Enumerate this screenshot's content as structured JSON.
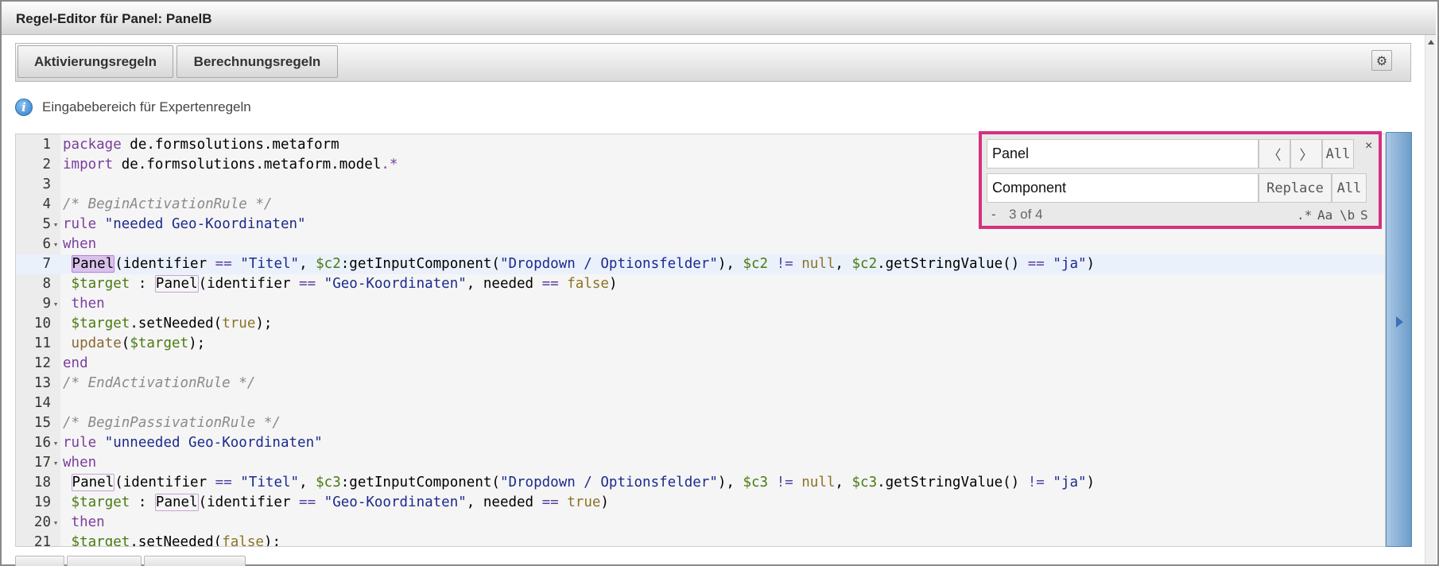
{
  "window": {
    "title": "Regel-Editor für Panel: PanelB"
  },
  "toolbar": {
    "activation_label": "Aktivierungsregeln",
    "calculation_label": "Berechnungsregeln",
    "settings_glyph": "⚙"
  },
  "info": {
    "icon_glyph": "i",
    "text": "Eingabebereich für Expertenregeln"
  },
  "search": {
    "find_value": "Panel",
    "replace_value": "Component",
    "prev_glyph": "〈",
    "next_glyph": "〉",
    "find_all_label": "All",
    "replace_label": "Replace",
    "replace_all_label": "All",
    "close_glyph": "×",
    "toggle_glyph": "-",
    "counter": "3 of 4",
    "opt_regex": ".*",
    "opt_case": "Aa",
    "opt_word": "\\b",
    "opt_selection": "S"
  },
  "editor": {
    "fold_glyph": "▾",
    "lines": [
      {
        "n": "1",
        "t": "package de.formsolutions.metaform"
      },
      {
        "n": "2",
        "t": "import de.formsolutions.metaform.model.*"
      },
      {
        "n": "3",
        "t": ""
      },
      {
        "n": "4",
        "t": "/* BeginActivationRule */"
      },
      {
        "n": "5",
        "t": "rule \"needed Geo-Koordinaten\""
      },
      {
        "n": "6",
        "t": "when"
      },
      {
        "n": "7",
        "t": " Panel(identifier == \"Titel\", $c2:getInputComponent(\"Dropdown / Optionsfelder\"), $c2 != null, $c2.getStringValue() == \"ja\")"
      },
      {
        "n": "8",
        "t": " $target : Panel(identifier == \"Geo-Koordinaten\", needed == false)"
      },
      {
        "n": "9",
        "t": " then"
      },
      {
        "n": "10",
        "t": " $target.setNeeded(true);"
      },
      {
        "n": "11",
        "t": " update($target);"
      },
      {
        "n": "12",
        "t": "end"
      },
      {
        "n": "13",
        "t": "/* EndActivationRule */"
      },
      {
        "n": "14",
        "t": ""
      },
      {
        "n": "15",
        "t": "/* BeginPassivationRule */"
      },
      {
        "n": "16",
        "t": "rule \"unneeded Geo-Koordinaten\""
      },
      {
        "n": "17",
        "t": "when"
      },
      {
        "n": "18",
        "t": " Panel(identifier == \"Titel\", $c3:getInputComponent(\"Dropdown / Optionsfelder\"), $c3 != null, $c3.getStringValue() != \"ja\")"
      },
      {
        "n": "19",
        "t": " $target : Panel(identifier == \"Geo-Koordinaten\", needed == true)"
      },
      {
        "n": "20",
        "t": " then"
      },
      {
        "n": "21",
        "t": " $target.setNeeded(false);"
      }
    ]
  }
}
